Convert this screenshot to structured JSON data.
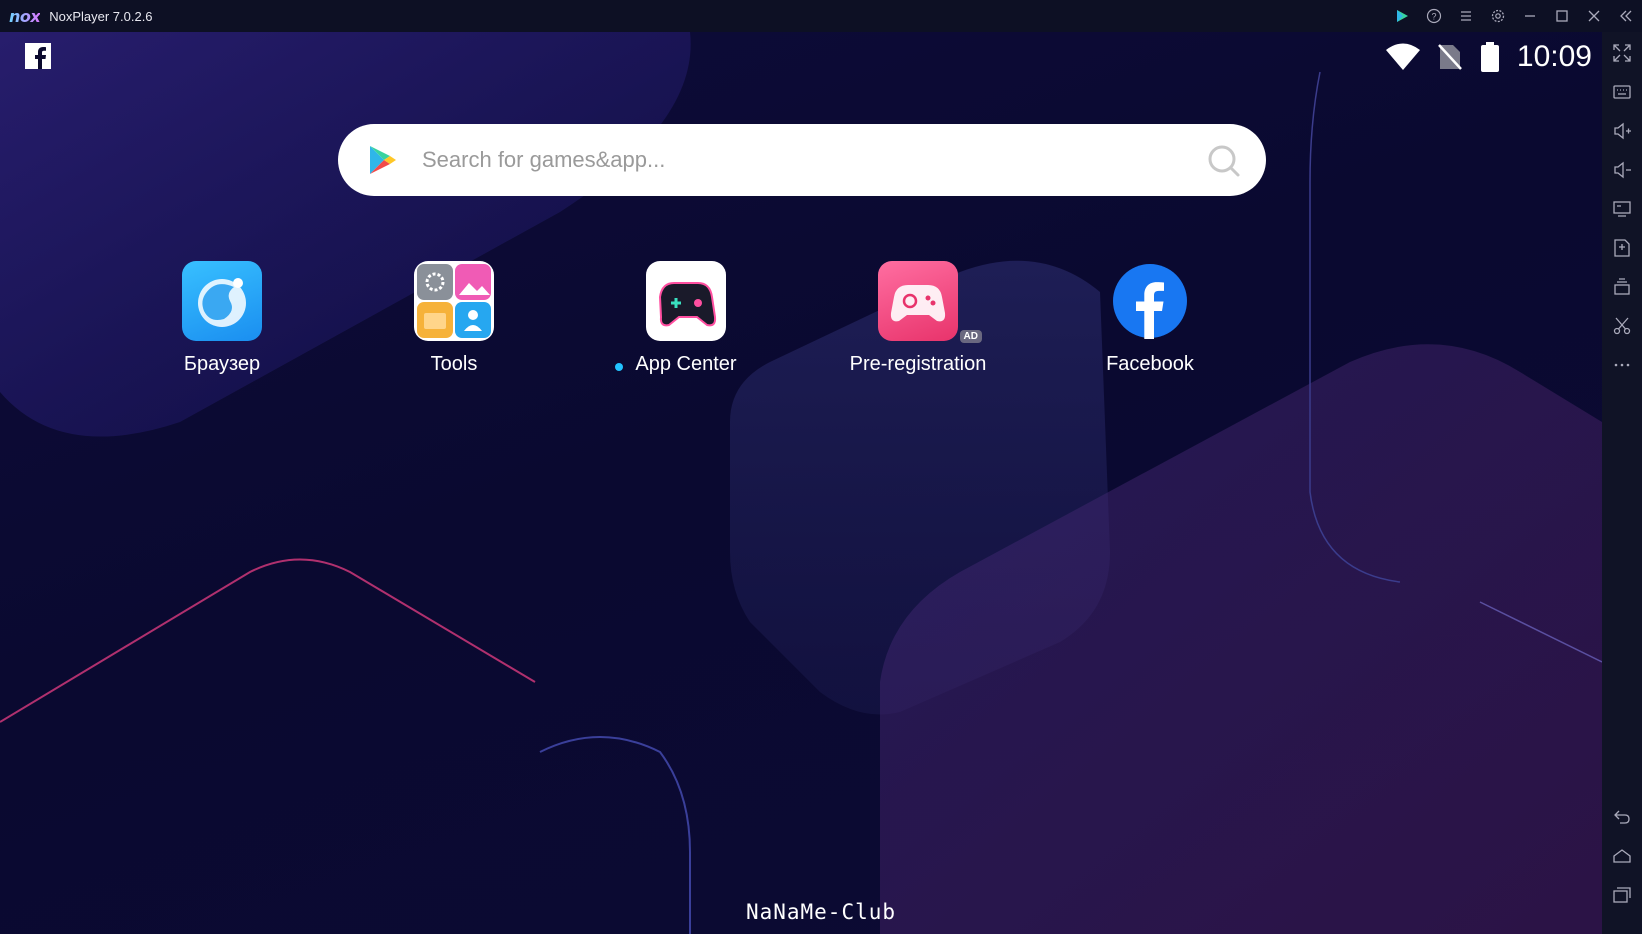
{
  "window": {
    "logo": "nox",
    "title": "NoxPlayer 7.0.2.6",
    "controls": [
      "play-store-icon",
      "help-icon",
      "menu-icon",
      "settings-icon",
      "minimize-icon",
      "maximize-icon",
      "close-icon",
      "collapse-sidebar-icon"
    ]
  },
  "status_bar": {
    "time": "10:09",
    "icons": [
      "wifi-icon",
      "no-sim-icon",
      "battery-icon"
    ]
  },
  "search": {
    "placeholder": "Search for games&app..."
  },
  "apps": [
    {
      "label": "Браузер",
      "icon": "browser-icon"
    },
    {
      "label": "Tools",
      "icon": "tools-folder-icon"
    },
    {
      "label": "App Center",
      "icon": "app-center-icon",
      "new_dot": true
    },
    {
      "label": "Pre-registration",
      "icon": "pre-registration-icon",
      "badge": "AD"
    },
    {
      "label": "Facebook",
      "icon": "facebook-icon"
    }
  ],
  "watermark": "NaNaMe-Club",
  "sidebar": {
    "top_tools": [
      "fullscreen-icon",
      "keyboard-icon",
      "volume-up-icon",
      "volume-down-icon",
      "screen-icon",
      "add-apk-icon",
      "multi-instance-icon",
      "scissors-icon",
      "more-icon"
    ],
    "bottom_tools": [
      "back-icon",
      "home-icon",
      "recent-apps-icon"
    ]
  },
  "colors": {
    "background": "#0b0a2e",
    "titlebar": "#0d1024",
    "sidebar": "#101326",
    "notification_dot": "#22c3ff",
    "facebook_blue": "#1877f2"
  }
}
